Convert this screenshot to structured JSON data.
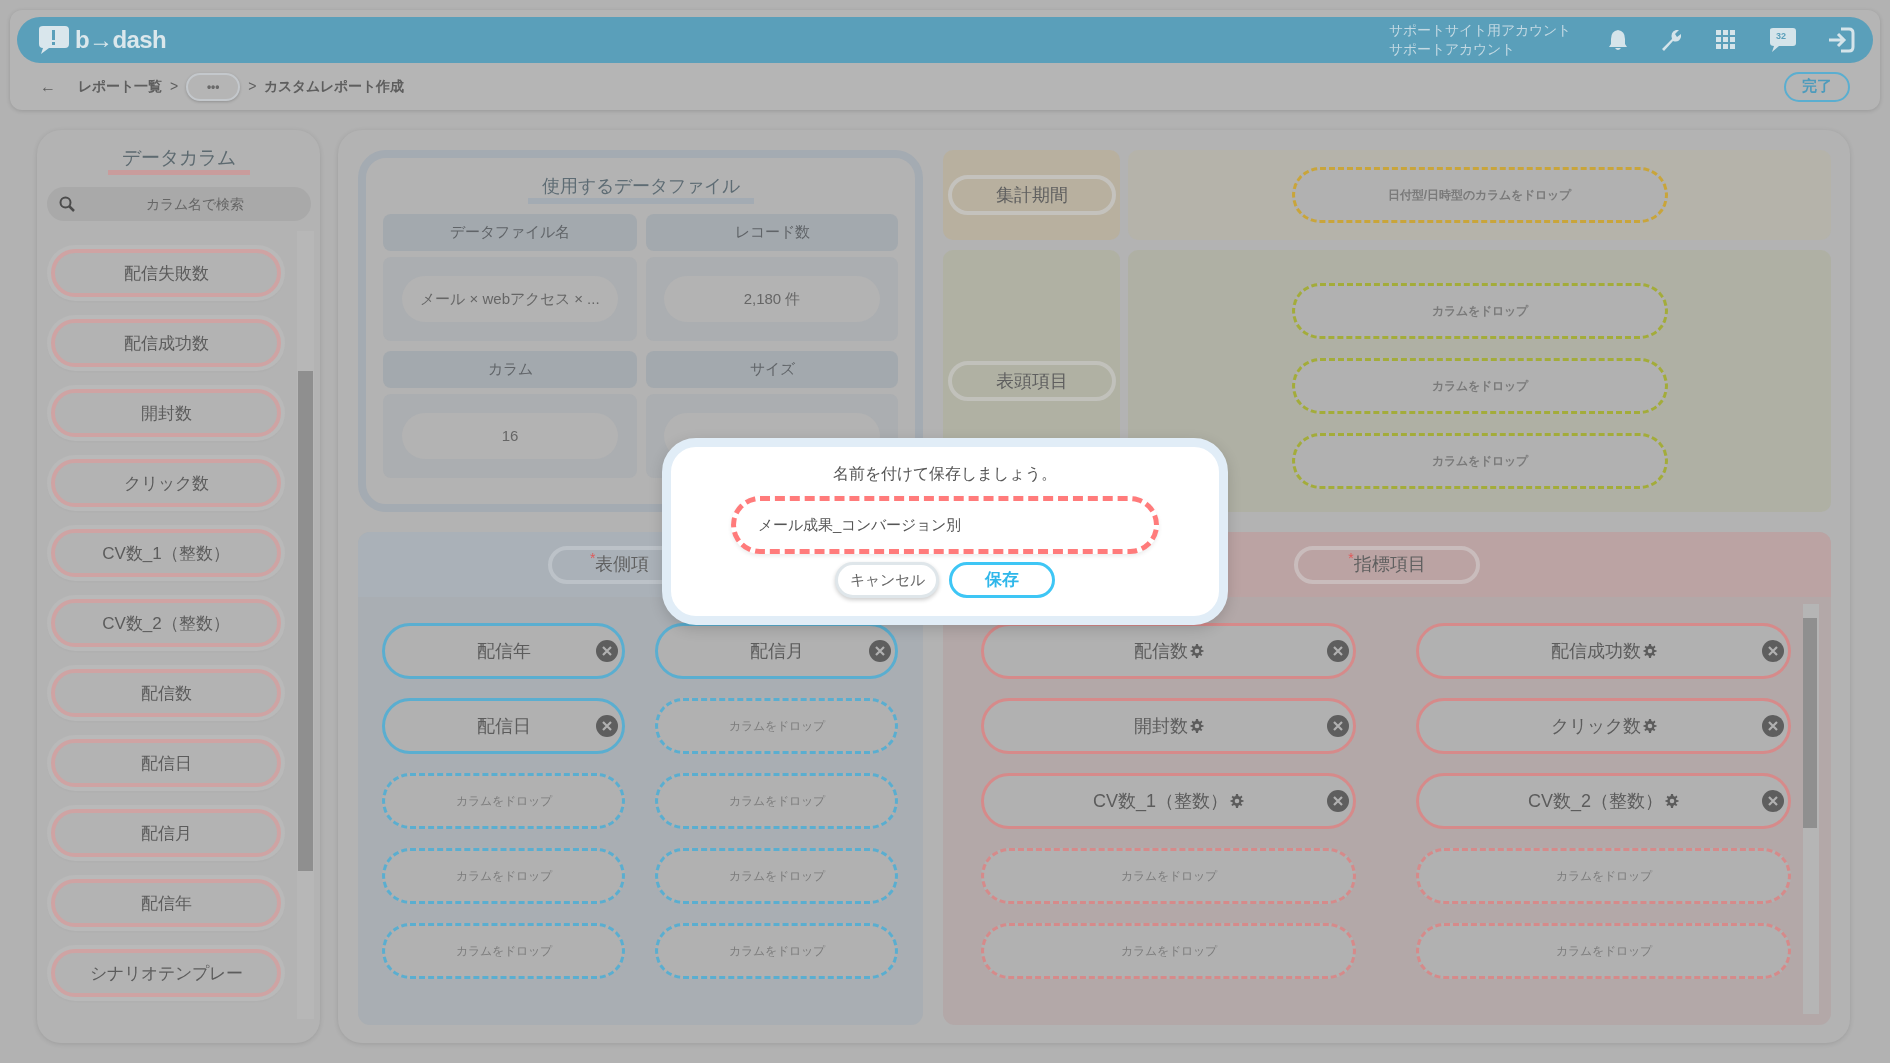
{
  "header": {
    "logo": "b→dash",
    "account_lines": [
      "サポートサイト用アカウント",
      "サポートアカウント"
    ],
    "chat_badge": "32"
  },
  "breadcrumb": {
    "back": "←",
    "items": [
      {
        "kind": "link",
        "text": "レポート一覧"
      },
      {
        "kind": "more",
        "text": "•••"
      },
      {
        "kind": "current",
        "text": "カスタムレポート作成"
      }
    ],
    "separator": ">",
    "done_button": "完了"
  },
  "sidebar": {
    "title": "データカラム",
    "search_placeholder": "カラム名で検索",
    "items": [
      "配信失敗数",
      "配信成功数",
      "開封数",
      "クリック数",
      "CV数_1（整数）",
      "CV数_2（整数）",
      "配信数",
      "配信日",
      "配信月",
      "配信年",
      "シナリオテンプレー"
    ]
  },
  "data_file": {
    "title": "使用するデータファイル",
    "fields": [
      {
        "label": "データファイル名",
        "value": "メール × webアクセス × ..."
      },
      {
        "label": "レコード数",
        "value": "2,180 件"
      },
      {
        "label": "カラム",
        "value": "16"
      },
      {
        "label": "サイズ"
      }
    ]
  },
  "period": {
    "label": "集計期間",
    "drop": "日付型/日時型のカラムをドロップ"
  },
  "column_header": {
    "label": "表頭項目",
    "slots": [
      "カラムをドロップ",
      "カラムをドロップ",
      "カラムをドロップ"
    ]
  },
  "row_header": {
    "label": "表側項",
    "required": true,
    "required_mark": "*",
    "slots": [
      {
        "kind": "filled",
        "text": "配信年",
        "settings": false
      },
      {
        "kind": "filled",
        "text": "配信月",
        "settings": false
      },
      {
        "kind": "filled",
        "text": "配信日",
        "settings": false
      },
      {
        "kind": "empty",
        "text": "カラムをドロップ"
      },
      {
        "kind": "empty",
        "text": "カラムをドロップ"
      },
      {
        "kind": "empty",
        "text": "カラムをドロップ"
      },
      {
        "kind": "empty",
        "text": "カラムをドロップ"
      },
      {
        "kind": "empty",
        "text": "カラムをドロップ"
      },
      {
        "kind": "empty",
        "text": "カラムをドロップ"
      },
      {
        "kind": "empty",
        "text": "カラムをドロップ"
      }
    ]
  },
  "metrics": {
    "label": "指標項目",
    "required": true,
    "required_mark": "*",
    "slots": [
      {
        "kind": "filled",
        "text": "配信数",
        "settings": true
      },
      {
        "kind": "filled",
        "text": "配信成功数",
        "settings": true
      },
      {
        "kind": "filled",
        "text": "開封数",
        "settings": true
      },
      {
        "kind": "filled",
        "text": "クリック数",
        "settings": true
      },
      {
        "kind": "filled",
        "text": "CV数_1（整数）",
        "settings": true
      },
      {
        "kind": "filled",
        "text": "CV数_2（整数）",
        "settings": true
      },
      {
        "kind": "empty",
        "text": "カラムをドロップ"
      },
      {
        "kind": "empty",
        "text": "カラムをドロップ"
      },
      {
        "kind": "empty",
        "text": "カラムをドロップ"
      },
      {
        "kind": "empty",
        "text": "カラムをドロップ"
      }
    ]
  },
  "modal": {
    "message": "名前を付けて保存しましょう。",
    "input_value": "メール成果_コンバージョン別",
    "buttons": [
      {
        "kind": "secondary",
        "label": "キャンセル"
      },
      {
        "kind": "primary",
        "label": "保存"
      }
    ]
  }
}
